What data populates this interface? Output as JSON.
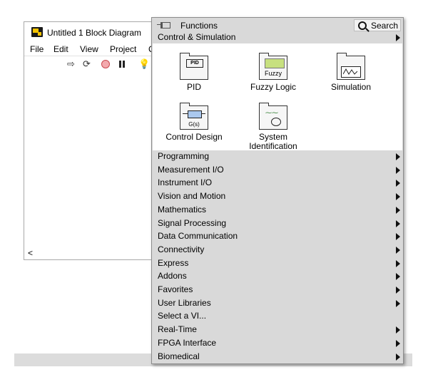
{
  "block_diagram": {
    "title": "Untitled 1 Block Diagram",
    "menu": [
      "File",
      "Edit",
      "View",
      "Project",
      "C"
    ],
    "scroll_left": "<"
  },
  "palette": {
    "title": "Functions",
    "search_label": "Search",
    "subpalette": "Control & Simulation",
    "items": [
      {
        "label": "PID",
        "icon": "pid-icon"
      },
      {
        "label": "Fuzzy Logic",
        "icon": "fuzzy-logic-icon",
        "icon_text": "Fuzzy"
      },
      {
        "label": "Simulation",
        "icon": "simulation-icon"
      },
      {
        "label": "Control Design",
        "icon": "control-design-icon",
        "icon_text": "G(s)"
      },
      {
        "label": "System Identification",
        "icon": "system-identification-icon"
      }
    ],
    "pid_tag": "PID",
    "categories": [
      {
        "label": "Programming",
        "arrow": true
      },
      {
        "label": "Measurement I/O",
        "arrow": true
      },
      {
        "label": "Instrument I/O",
        "arrow": true
      },
      {
        "label": "Vision and Motion",
        "arrow": true
      },
      {
        "label": "Mathematics",
        "arrow": true
      },
      {
        "label": "Signal Processing",
        "arrow": true
      },
      {
        "label": "Data Communication",
        "arrow": true
      },
      {
        "label": "Connectivity",
        "arrow": true
      },
      {
        "label": "Express",
        "arrow": true
      },
      {
        "label": "Addons",
        "arrow": true
      },
      {
        "label": "Favorites",
        "arrow": true
      },
      {
        "label": "User Libraries",
        "arrow": true
      },
      {
        "label": "Select a VI...",
        "arrow": false
      },
      {
        "label": "Real-Time",
        "arrow": true
      },
      {
        "label": "FPGA Interface",
        "arrow": true
      },
      {
        "label": "Biomedical",
        "arrow": true
      }
    ]
  }
}
